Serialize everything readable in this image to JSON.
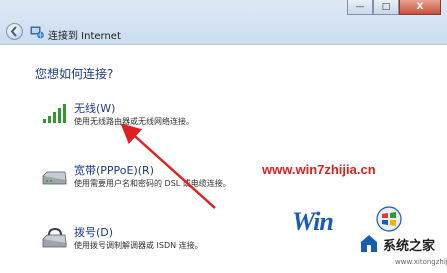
{
  "window": {
    "title": "连接到 Internet",
    "minimize_glyph": "—",
    "maximize_glyph": "□",
    "close_glyph": "X"
  },
  "question": "您想如何连接?",
  "options": [
    {
      "icon": "wireless-signal-icon",
      "title": "无线(W)",
      "desc": "使用无线路由器或无线网络连接。"
    },
    {
      "icon": "broadband-modem-icon",
      "title": "宽带(PPPoE)(R)",
      "desc": "使用需要用户名和密码的 DSL 或电缆连接。"
    },
    {
      "icon": "dialup-modem-icon",
      "title": "拨号(D)",
      "desc": "使用拨号调制解调器或 ISDN 连接。"
    }
  ],
  "watermark": {
    "url": "www.win7zhijia.cn",
    "logo_text": "Win",
    "brand": "系统之家",
    "small_url": "www.xitongzhijia.net"
  },
  "colors": {
    "title_text": "#1f3b8a",
    "annotation_arrow": "#e02020",
    "logo_blue": "#1a5bb5"
  }
}
